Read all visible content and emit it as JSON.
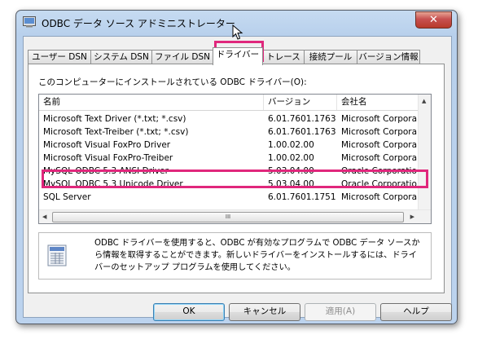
{
  "window": {
    "title": "ODBC データ ソース アドミニストレーター",
    "close_label": "✕"
  },
  "tabs": [
    {
      "label": "ユーザー DSN",
      "active": false
    },
    {
      "label": "システム DSN",
      "active": false
    },
    {
      "label": "ファイル DSN",
      "active": false
    },
    {
      "label": "ドライバー",
      "active": true
    },
    {
      "label": "トレース",
      "active": false
    },
    {
      "label": "接続プール",
      "active": false
    },
    {
      "label": "バージョン情報",
      "active": false
    }
  ],
  "drivers_panel": {
    "caption": "このコンピューターにインストールされている ODBC ドライバー(O):",
    "columns": [
      "名前",
      "バージョン",
      "会社名"
    ],
    "rows": [
      {
        "name": "Microsoft Text Driver (*.txt; *.csv)",
        "version": "6.01.7601.17632",
        "company": "Microsoft Corpora"
      },
      {
        "name": "Microsoft Text-Treiber (*.txt; *.csv)",
        "version": "6.01.7601.17632",
        "company": "Microsoft Corpora"
      },
      {
        "name": "Microsoft Visual FoxPro Driver",
        "version": "1.00.02.00",
        "company": "Microsoft Corpora"
      },
      {
        "name": "Microsoft Visual FoxPro-Treiber",
        "version": "1.00.02.00",
        "company": "Microsoft Corpora"
      },
      {
        "name": "MySQL ODBC 5.3 ANSI Driver",
        "version": "5.03.04.00",
        "company": "Oracle Corporatio"
      },
      {
        "name": "MySQL ODBC 5.3 Unicode Driver",
        "version": "5.03.04.00",
        "company": "Oracle Corporatio",
        "highlighted": true
      },
      {
        "name": "SQL Server",
        "version": "6.01.7601.17514",
        "company": "Microsoft Corpora"
      }
    ],
    "hscroll_grip": "III"
  },
  "info": {
    "text": "ODBC ドライバーを使用すると、ODBC が有効なプログラムで ODBC データ ソースから情報を取得することができます。新しいドライバーをインストールするには、ドライバーのセットアップ プログラムを使用してください。"
  },
  "buttons": {
    "ok": "OK",
    "cancel": "キャンセル",
    "apply": "適用(A)",
    "help": "ヘルプ"
  },
  "colors": {
    "highlight": "#e0277c",
    "title_bar": "#c6dbf1"
  }
}
